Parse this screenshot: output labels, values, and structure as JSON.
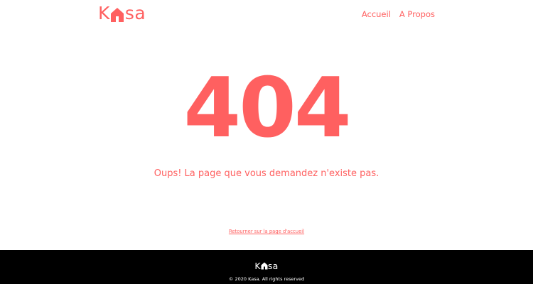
{
  "header": {
    "logo": {
      "prefix": "K",
      "icon": "house-icon",
      "suffix": "sa"
    },
    "nav": {
      "home": "Accueil",
      "about": "A Propos"
    }
  },
  "main": {
    "error_code": "404",
    "message": "Oups! La page que vous demandez n'existe pas.",
    "home_link": "Retourner sur la page d'accueil"
  },
  "footer": {
    "logo": {
      "prefix": "K",
      "icon": "house-icon",
      "suffix": "sa"
    },
    "copyright": "© 2020 Kasa. All rights reserved"
  },
  "colors": {
    "brand": "#ff6060",
    "footer_bg": "#000000",
    "footer_text": "#ffffff",
    "background": "#ffffff"
  }
}
